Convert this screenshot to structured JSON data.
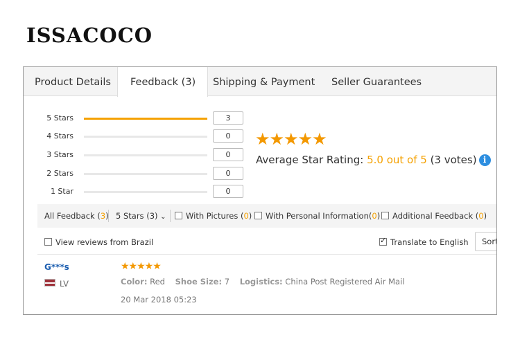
{
  "brand": "ISSACOCO",
  "tabs": [
    {
      "label": "Product Details",
      "active": false
    },
    {
      "label": "Feedback (3)",
      "active": true
    },
    {
      "label": "Shipping & Payment",
      "active": false
    },
    {
      "label": "Seller Guarantees",
      "active": false
    }
  ],
  "histogram": [
    {
      "label": "5 Stars",
      "count": "3",
      "fraction": 1.0
    },
    {
      "label": "4 Stars",
      "count": "0",
      "fraction": 0
    },
    {
      "label": "3 Stars",
      "count": "0",
      "fraction": 0
    },
    {
      "label": "2 Stars",
      "count": "0",
      "fraction": 0
    },
    {
      "label": "1 Star",
      "count": "0",
      "fraction": 0
    }
  ],
  "rating": {
    "stars": "★★★★★",
    "label": "Average Star Rating: ",
    "score": "5.0 out of 5",
    "votes": " (3 votes)",
    "info_glyph": "i"
  },
  "filters": {
    "all_label": "All Feedback (",
    "all_count": "3",
    "all_close": ")",
    "stars_select": "5 Stars (3)",
    "stars_chevron": "⌄",
    "pictures_label": "With Pictures (",
    "pictures_count": "0",
    "pictures_close": ")",
    "personal_label": "With Personal Information(",
    "personal_count": "0",
    "personal_close": ")",
    "additional_label": "Additional Feedback (",
    "additional_count": "0",
    "additional_close": ")"
  },
  "options": {
    "brazil_label": "View reviews from Brazil",
    "brazil_checked": false,
    "translate_label": "Translate to English",
    "translate_checked": true,
    "sort_label": "Sort"
  },
  "review": {
    "reviewer": "G***s",
    "country": "LV",
    "stars": "★★★★★",
    "color_label": "Color:",
    "color_value": " Red",
    "shoe_label": "Shoe Size:",
    "shoe_value": " 7",
    "logistics_label": "Logistics:",
    "logistics_value": " China Post Registered Air Mail",
    "date": "20 Mar 2018 05:23"
  },
  "colors": {
    "accent": "#f5a100",
    "link": "#1c5eb0",
    "info": "#2d8ee0"
  }
}
